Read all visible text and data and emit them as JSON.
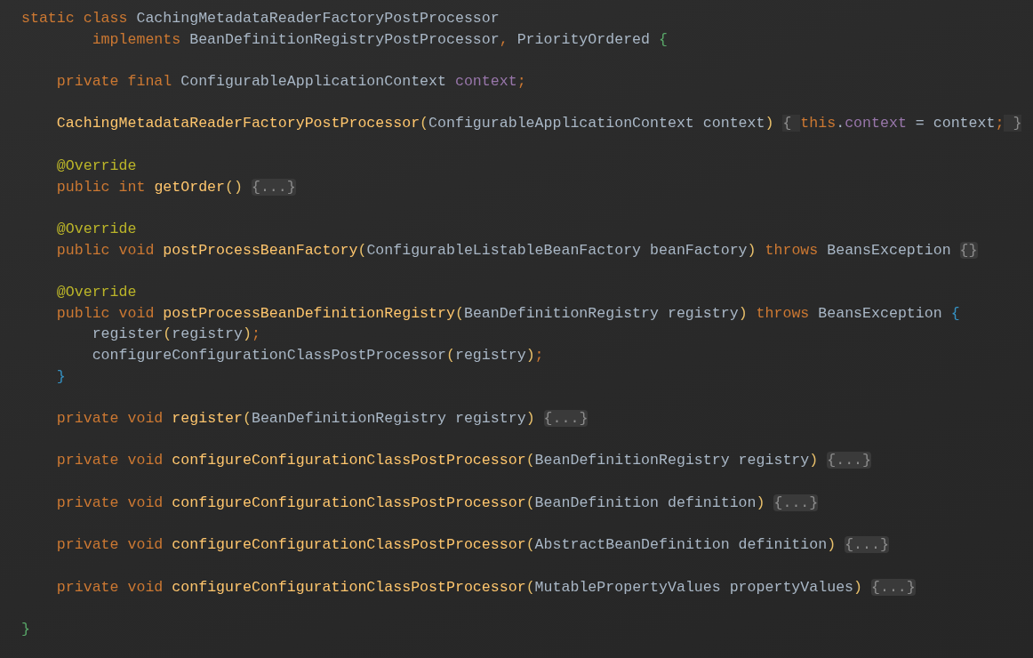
{
  "editor": {
    "lines": [
      {
        "kind": "code",
        "tokens": [
          {
            "kind": "keyword",
            "text": "static class "
          },
          {
            "kind": "plain",
            "text": "CachingMetadataReaderFactoryPostProcessor"
          }
        ]
      },
      {
        "kind": "code",
        "tokens": [
          {
            "kind": "keyword",
            "text": "        implements "
          },
          {
            "kind": "plain",
            "text": "BeanDefinitionRegistryPostProcessor"
          },
          {
            "kind": "keyword",
            "text": ", "
          },
          {
            "kind": "plain",
            "text": "PriorityOrdered "
          },
          {
            "kind": "green-brace",
            "text": "{"
          }
        ]
      },
      {
        "kind": "blank"
      },
      {
        "kind": "code",
        "tokens": [
          {
            "kind": "keyword",
            "text": "    private final "
          },
          {
            "kind": "plain",
            "text": "ConfigurableApplicationContext "
          },
          {
            "kind": "field",
            "text": "context"
          },
          {
            "kind": "keyword",
            "text": ";"
          }
        ]
      },
      {
        "kind": "blank"
      },
      {
        "kind": "code",
        "tokens": [
          {
            "kind": "method",
            "text": "    CachingMetadataReaderFactoryPostProcessor"
          },
          {
            "kind": "paren",
            "text": "("
          },
          {
            "kind": "plain",
            "text": "ConfigurableApplicationContext context"
          },
          {
            "kind": "paren",
            "text": ") "
          },
          {
            "kind": "fold-brace",
            "text": "{ "
          },
          {
            "kind": "keyword",
            "text": "this"
          },
          {
            "kind": "plain",
            "text": "."
          },
          {
            "kind": "field",
            "text": "context"
          },
          {
            "kind": "plain",
            "text": " = context"
          },
          {
            "kind": "keyword",
            "text": ";"
          },
          {
            "kind": "fold-brace",
            "text": " }"
          }
        ]
      },
      {
        "kind": "blank"
      },
      {
        "kind": "code",
        "tokens": [
          {
            "kind": "annotation",
            "text": "    @Override"
          }
        ]
      },
      {
        "kind": "code",
        "tokens": [
          {
            "kind": "keyword",
            "text": "    public int "
          },
          {
            "kind": "method",
            "text": "getOrder"
          },
          {
            "kind": "paren",
            "text": "() "
          },
          {
            "kind": "fold",
            "text": "{...}"
          }
        ]
      },
      {
        "kind": "blank"
      },
      {
        "kind": "code",
        "tokens": [
          {
            "kind": "annotation",
            "text": "    @Override"
          }
        ]
      },
      {
        "kind": "code",
        "tokens": [
          {
            "kind": "keyword",
            "text": "    public void "
          },
          {
            "kind": "method",
            "text": "postProcessBeanFactory"
          },
          {
            "kind": "paren",
            "text": "("
          },
          {
            "kind": "plain",
            "text": "ConfigurableListableBeanFactory beanFactory"
          },
          {
            "kind": "paren",
            "text": ")"
          },
          {
            "kind": "keyword",
            "text": " throws "
          },
          {
            "kind": "plain",
            "text": "BeansException "
          },
          {
            "kind": "fold",
            "text": "{}"
          }
        ]
      },
      {
        "kind": "blank"
      },
      {
        "kind": "code",
        "tokens": [
          {
            "kind": "annotation",
            "text": "    @Override"
          }
        ]
      },
      {
        "kind": "code",
        "tokens": [
          {
            "kind": "keyword",
            "text": "    public void "
          },
          {
            "kind": "method",
            "text": "postProcessBeanDefinitionRegistry"
          },
          {
            "kind": "paren",
            "text": "("
          },
          {
            "kind": "plain",
            "text": "BeanDefinitionRegistry registry"
          },
          {
            "kind": "paren",
            "text": ")"
          },
          {
            "kind": "keyword",
            "text": " throws "
          },
          {
            "kind": "plain",
            "text": "BeansException "
          },
          {
            "kind": "blue-brace",
            "text": "{"
          }
        ]
      },
      {
        "kind": "code",
        "tokens": [
          {
            "kind": "plain",
            "text": "        register"
          },
          {
            "kind": "paren",
            "text": "("
          },
          {
            "kind": "plain",
            "text": "registry"
          },
          {
            "kind": "paren",
            "text": ")"
          },
          {
            "kind": "keyword",
            "text": ";"
          }
        ]
      },
      {
        "kind": "code",
        "tokens": [
          {
            "kind": "plain",
            "text": "        configureConfigurationClassPostProcessor"
          },
          {
            "kind": "paren",
            "text": "("
          },
          {
            "kind": "plain",
            "text": "registry"
          },
          {
            "kind": "paren",
            "text": ")"
          },
          {
            "kind": "keyword",
            "text": ";"
          }
        ]
      },
      {
        "kind": "code",
        "tokens": [
          {
            "kind": "blue-brace",
            "text": "    }"
          }
        ]
      },
      {
        "kind": "blank"
      },
      {
        "kind": "code",
        "tokens": [
          {
            "kind": "keyword",
            "text": "    private void "
          },
          {
            "kind": "method",
            "text": "register"
          },
          {
            "kind": "paren",
            "text": "("
          },
          {
            "kind": "plain",
            "text": "BeanDefinitionRegistry registry"
          },
          {
            "kind": "paren",
            "text": ") "
          },
          {
            "kind": "fold",
            "text": "{...}"
          }
        ]
      },
      {
        "kind": "blank"
      },
      {
        "kind": "code",
        "tokens": [
          {
            "kind": "keyword",
            "text": "    private void "
          },
          {
            "kind": "method",
            "text": "configureConfigurationClassPostProcessor"
          },
          {
            "kind": "paren",
            "text": "("
          },
          {
            "kind": "plain",
            "text": "BeanDefinitionRegistry registry"
          },
          {
            "kind": "paren",
            "text": ") "
          },
          {
            "kind": "fold",
            "text": "{...}"
          }
        ]
      },
      {
        "kind": "blank"
      },
      {
        "kind": "code",
        "tokens": [
          {
            "kind": "keyword",
            "text": "    private void "
          },
          {
            "kind": "method",
            "text": "configureConfigurationClassPostProcessor"
          },
          {
            "kind": "paren",
            "text": "("
          },
          {
            "kind": "plain",
            "text": "BeanDefinition definition"
          },
          {
            "kind": "paren",
            "text": ") "
          },
          {
            "kind": "fold",
            "text": "{...}"
          }
        ]
      },
      {
        "kind": "blank"
      },
      {
        "kind": "code",
        "tokens": [
          {
            "kind": "keyword",
            "text": "    private void "
          },
          {
            "kind": "method",
            "text": "configureConfigurationClassPostProcessor"
          },
          {
            "kind": "paren",
            "text": "("
          },
          {
            "kind": "plain",
            "text": "AbstractBeanDefinition definition"
          },
          {
            "kind": "paren",
            "text": ") "
          },
          {
            "kind": "fold",
            "text": "{...}"
          }
        ]
      },
      {
        "kind": "blank"
      },
      {
        "kind": "code",
        "tokens": [
          {
            "kind": "keyword",
            "text": "    private void "
          },
          {
            "kind": "method",
            "text": "configureConfigurationClassPostProcessor"
          },
          {
            "kind": "paren",
            "text": "("
          },
          {
            "kind": "plain",
            "text": "MutablePropertyValues propertyValues"
          },
          {
            "kind": "paren",
            "text": ") "
          },
          {
            "kind": "fold",
            "text": "{...}"
          }
        ]
      },
      {
        "kind": "blank"
      },
      {
        "kind": "code",
        "tokens": [
          {
            "kind": "green-brace",
            "text": "}"
          }
        ]
      }
    ]
  }
}
